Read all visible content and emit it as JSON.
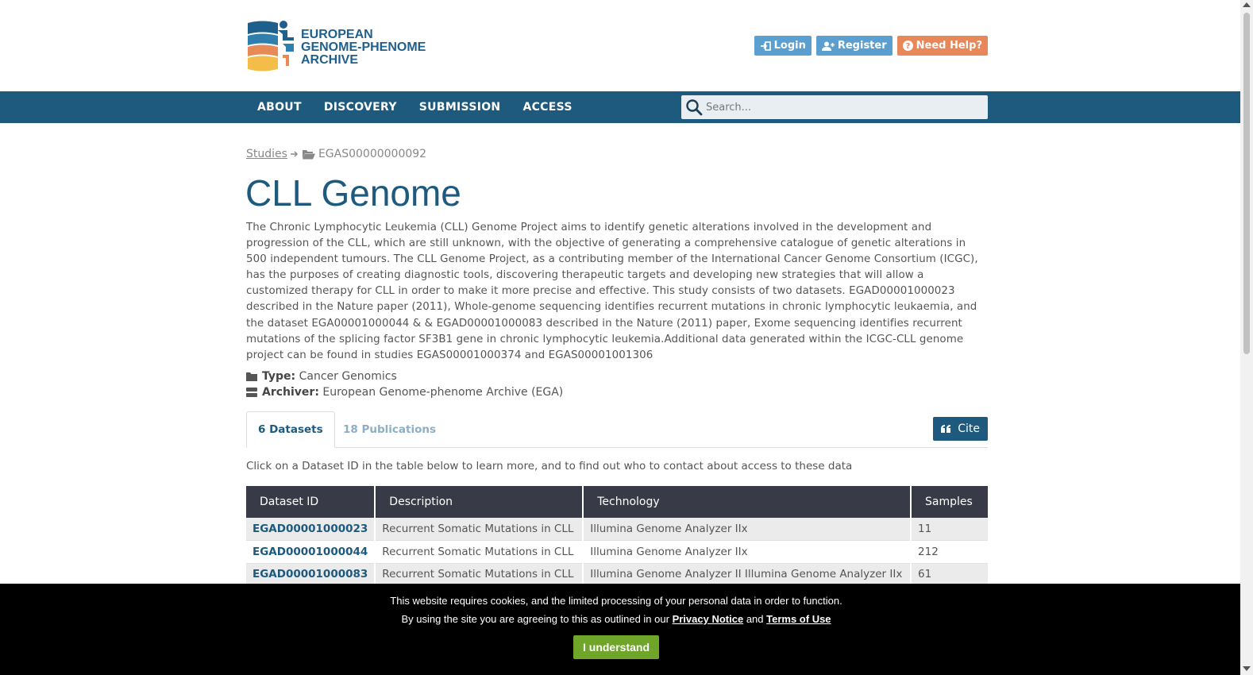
{
  "header": {
    "logo": {
      "line1": "EUROPEAN",
      "line2": "GENOME-PHENOME",
      "line3": "ARCHIVE"
    },
    "buttons": {
      "login": "Login",
      "register": "Register",
      "help": "Need Help?"
    }
  },
  "nav": {
    "items": [
      "ABOUT",
      "DISCOVERY",
      "SUBMISSION",
      "ACCESS"
    ],
    "search_placeholder": "Search..."
  },
  "breadcrumb": {
    "root": "Studies",
    "current": "EGAS00000000092"
  },
  "study": {
    "title": "CLL Genome",
    "description": "The Chronic Lymphocytic Leukemia (CLL) Genome Project aims to identify genetic alterations involved in the development and progression of the CLL, which are still unknown, with the objective of generating a comprehensive catalogue of genetic alterations in 500 independent tumours. The CLL Genome Project, as a contributing member of the International Cancer Genome Consortium (ICGC), has the purposes of creating diagnostic tools, discovering therapeutic targets and developing new strategies that will allow a customized therapy for CLL in order to make it more precise and effective. This study consists of two datasets. EGAD00001000023 described in the Nature paper (2011), Whole-genome sequencing identifies recurrent mutations in chronic lymphocytic leukaemia, and the dataset EGA00001000044 & & EGAD00001000083 described in the Nature (2011) paper, Exome sequencing identifies recurrent mutations of the splicing factor SF3B1 gene in chronic lymphocytic leukemia.Additional data generated within the ICGC-CLL genome project can be found in studies EGAS00001000374 and EGAS00001001306",
    "type_label": "Type:",
    "type_value": "Cancer Genomics",
    "archiver_label": "Archiver:",
    "archiver_value": "European Genome-phenome Archive (EGA)"
  },
  "tabs": {
    "datasets": "6 Datasets",
    "publications": "18 Publications",
    "cite": "Cite"
  },
  "hint": "Click on a Dataset ID in the table below to learn more, and to find out who to contact about access to these data",
  "table": {
    "headers": [
      "Dataset ID",
      "Description",
      "Technology",
      "Samples"
    ],
    "rows": [
      [
        "EGAD00001000023",
        "Recurrent Somatic Mutations in CLL",
        "Illumina Genome Analyzer IIx",
        "11"
      ],
      [
        "EGAD00001000044",
        "Recurrent Somatic Mutations in CLL",
        "Illumina Genome Analyzer IIx",
        "212"
      ],
      [
        "EGAD00001000083",
        "Recurrent Somatic Mutations in CLL",
        "Illumina Genome Analyzer II Illumina Genome Analyzer IIx",
        "61"
      ]
    ]
  },
  "cookie": {
    "line1": "This website requires cookies, and the limited processing of your personal data in order to function.",
    "line2_pre": "By using the site you are agreeing to this as outlined in our",
    "privacy": "Privacy Notice",
    "and": "and",
    "terms": "Terms of Use",
    "button": "I understand"
  },
  "colors": {
    "brand": "#1d5a7e",
    "accent_orange": "#e8875a",
    "button_blue": "#5b9fd0",
    "cookie_green": "#6fa528"
  }
}
